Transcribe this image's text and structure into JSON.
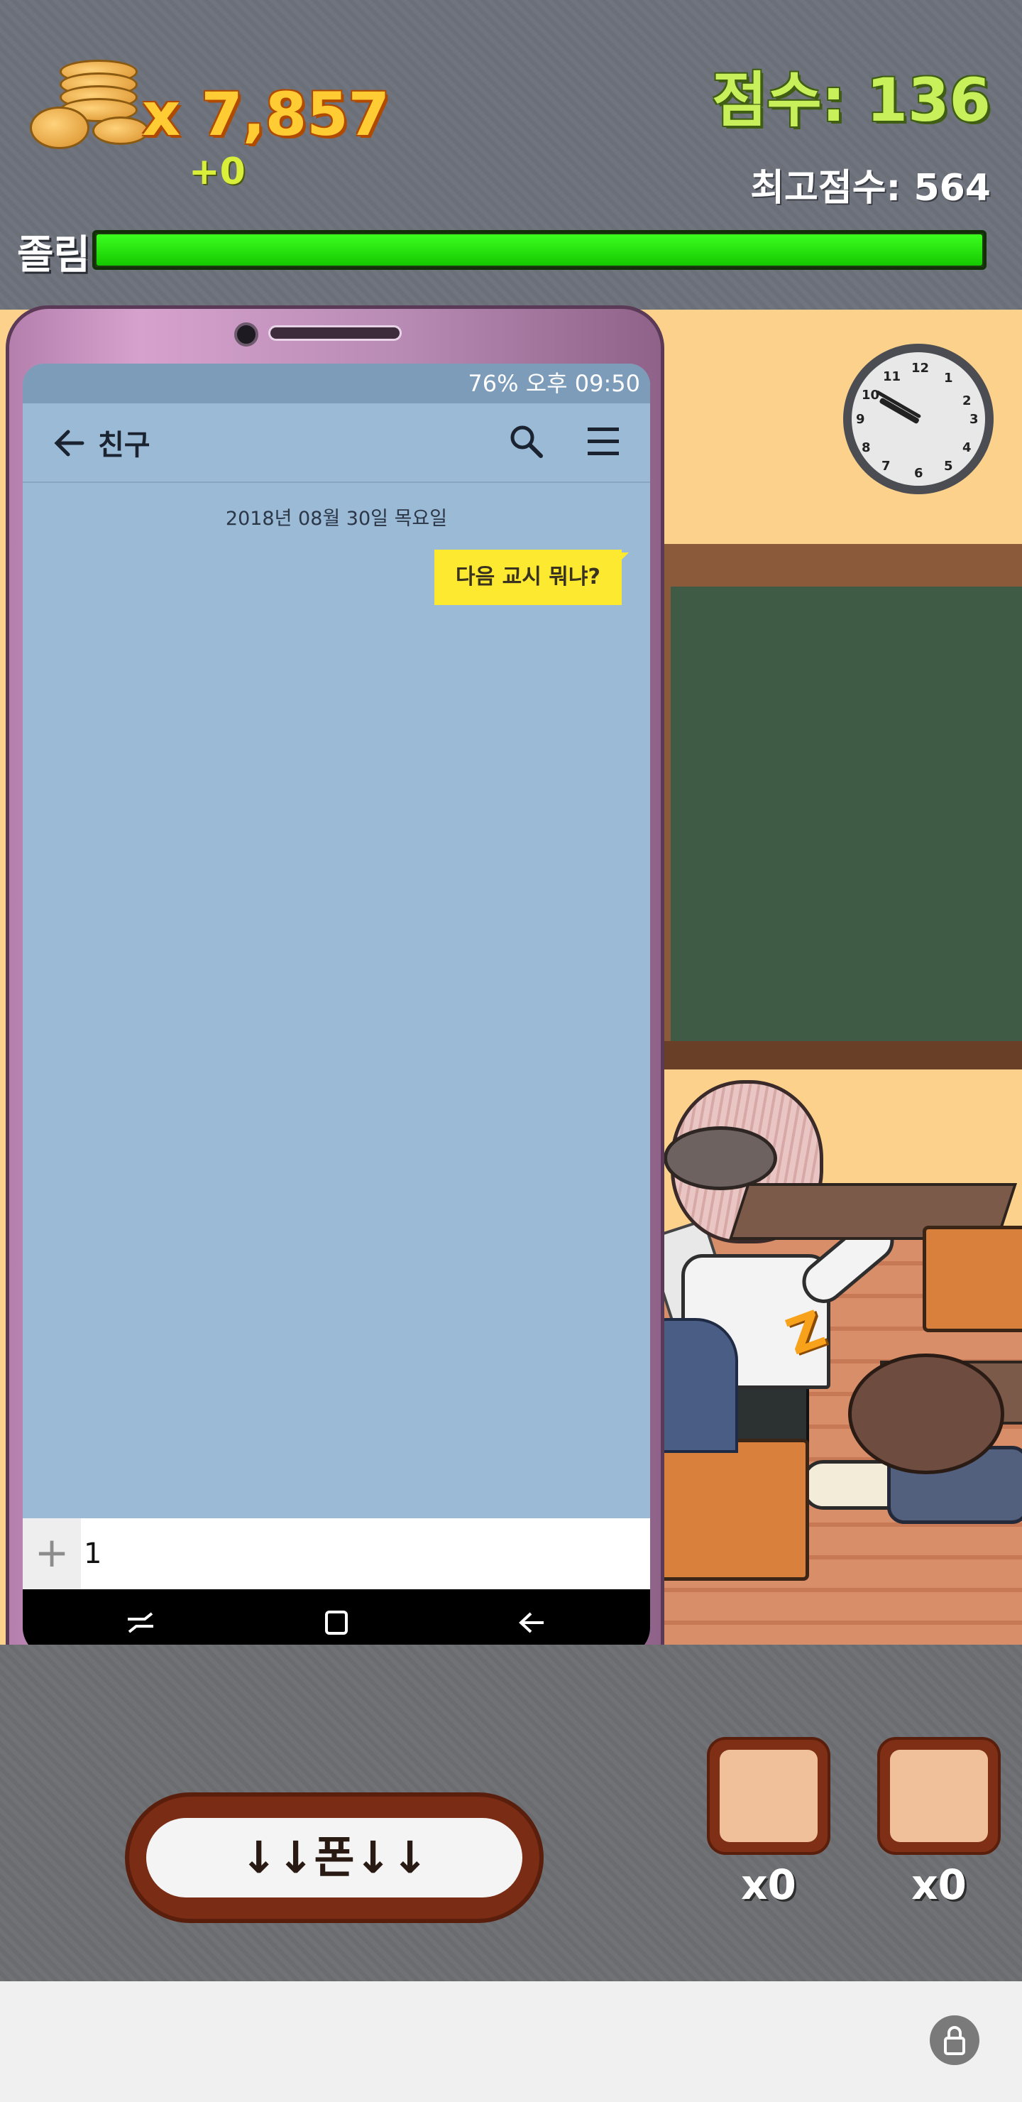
{
  "hud": {
    "coins": "x 7,857",
    "coins_delta": "+0",
    "score": "점수: 136",
    "high_score": "최고점수: 564",
    "drowsiness_label": "졸림",
    "drowsiness_level": 1.0
  },
  "scene": {
    "clock_time": "9:50",
    "clock_numbers": [
      "12",
      "1",
      "2",
      "3",
      "4",
      "5",
      "6",
      "7",
      "8",
      "9",
      "10",
      "11"
    ],
    "zzz_text": "Z"
  },
  "phone": {
    "status_bar": "76% 오후 09:50",
    "battery": "76%",
    "time": "오후 09:50",
    "chat_title": "친구",
    "date_divider": "2018년 08월 30일 목요일",
    "messages": [
      {
        "text": "다음 교시 뭐냐?",
        "from": "me"
      }
    ],
    "input_value": "1",
    "plus_label": "+",
    "icons": [
      "back-arrow-icon",
      "search-icon",
      "menu-icon",
      "recent-apps-icon",
      "home-icon",
      "back-icon"
    ]
  },
  "controls": {
    "phone_toggle_label": "↓↓폰↓↓",
    "items": [
      {
        "count": "x0"
      },
      {
        "count": "x0"
      }
    ]
  },
  "colors": {
    "bubble": "#fde92f",
    "chat_bg": "#9bbad6",
    "drowsy_bar": "#3bff1f",
    "coin_text": "#ffcc33",
    "score_text": "#c8f05a"
  }
}
